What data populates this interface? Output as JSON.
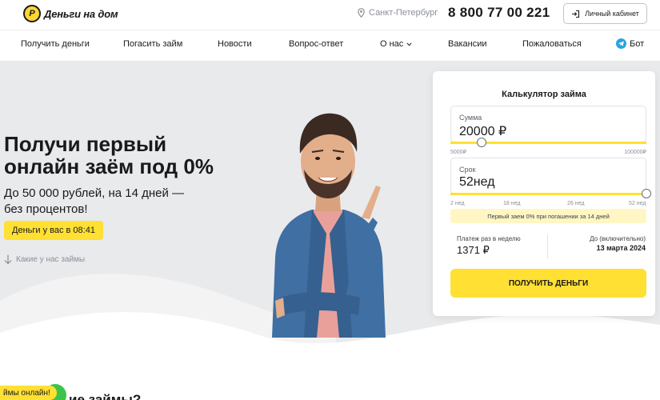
{
  "header": {
    "logo_mark": "Р",
    "logo_text": "Деньги на дом",
    "city": "Санкт-Петербург",
    "phone": "8 800 77 00 221",
    "cabinet_label": "Личный кабинет"
  },
  "nav": {
    "items": [
      {
        "label": "Получить деньги"
      },
      {
        "label": "Погасить займ"
      },
      {
        "label": "Новости"
      },
      {
        "label": "Вопрос-ответ"
      },
      {
        "label": "О нас"
      },
      {
        "label": "Вакансии"
      },
      {
        "label": "Пожаловаться"
      },
      {
        "label": "Бот"
      }
    ]
  },
  "hero": {
    "title": "Получи первый онлайн заём под 0%",
    "subtitle": "До 50 000 рублей, на 14 дней — без процентов!",
    "button_label": "Деньги у вас в 08:41",
    "link_label": "Какие у нас займы"
  },
  "calculator": {
    "title": "Калькулятор займа",
    "amount": {
      "label": "Сумма",
      "value": "20000 ₽",
      "min_label": "5000₽",
      "max_label": "100000₽",
      "min": 5000,
      "max": 100000,
      "current": 20000
    },
    "term": {
      "label": "Срок",
      "value": "52нед",
      "ticks": [
        "2 нед",
        "18 нед",
        "26 нед",
        "52 нед"
      ],
      "current_fraction": 1.0
    },
    "promo_text": "Первый заем 0% при погашении за 14 дней",
    "weekly_label": "Платеж раз в неделю",
    "weekly_value": "1371 ₽",
    "until_label": "До (включительно)",
    "until_value": "13 марта 2024",
    "submit_label": "ПОЛУЧИТЬ ДЕНЬГИ"
  },
  "bottom": {
    "badge": "ймы онлайн!",
    "heading_partial": "ие займы?"
  },
  "colors": {
    "accent": "#ffe033",
    "hero_bg": "#e9eaec",
    "promo_bg": "#fff6c4",
    "telegram": "#2aa3e0"
  }
}
